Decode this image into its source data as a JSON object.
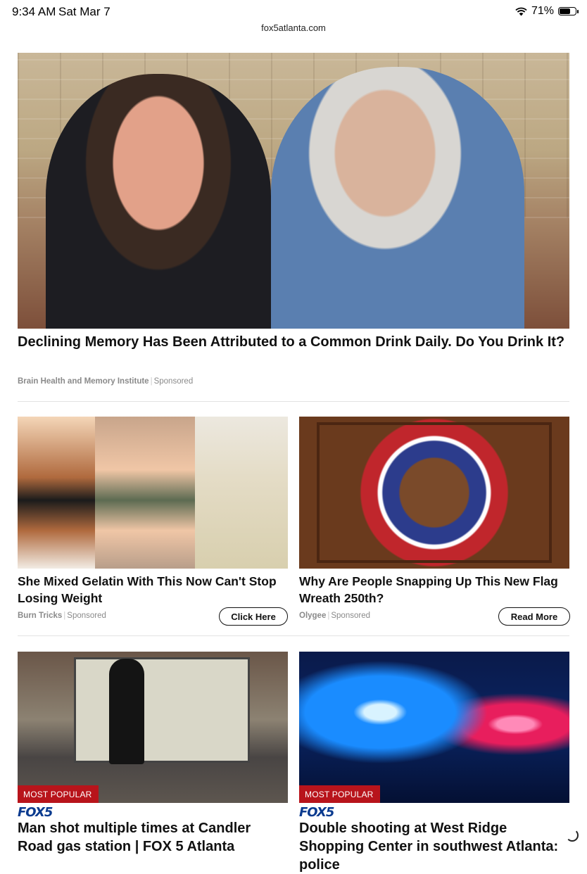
{
  "status_bar": {
    "time": "9:34 AM",
    "date": "Sat Mar 7",
    "battery": "71%",
    "battery_level": 0.71
  },
  "browser": {
    "url": "fox5atlanta.com"
  },
  "ads": [
    {
      "title": "Declining Memory Has Been Attributed to a Common Drink Daily. Do You Drink It?",
      "source": "Brain Health and Memory Institute",
      "sponsored": "Sponsored"
    },
    {
      "title": "She Mixed Gelatin With This Now Can't Stop Losing Weight",
      "source": "Burn Tricks",
      "sponsored": "Sponsored",
      "cta": "Click Here"
    },
    {
      "title": "Why Are People Snapping Up This New Flag Wreath 250th?",
      "source": "Olygee",
      "sponsored": "Sponsored",
      "cta": "Read More"
    }
  ],
  "news": [
    {
      "badge": "MOST POPULAR",
      "brand": "FOX5",
      "title": "Man shot multiple times at Candler Road gas station | FOX 5 Atlanta"
    },
    {
      "badge": "MOST POPULAR",
      "brand": "FOX5",
      "title": "Double shooting at West Ridge Shopping Center in southwest Atlanta: police"
    }
  ]
}
